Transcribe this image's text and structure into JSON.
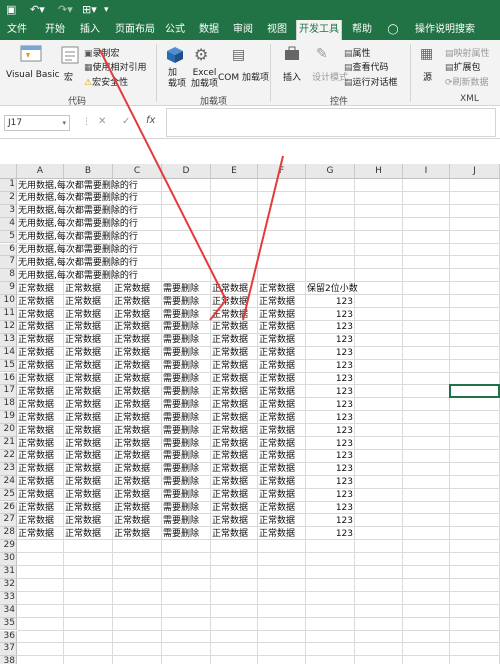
{
  "quick_access": {
    "save_icon": "save-icon",
    "undo_icon": "undo-icon",
    "redo_icon": "redo-icon",
    "touch_icon": "touch-mode-icon",
    "customize_icon": "customize-toolbar-icon"
  },
  "tabs": [
    {
      "label": "文件"
    },
    {
      "label": "开始"
    },
    {
      "label": "插入"
    },
    {
      "label": "页面布局"
    },
    {
      "label": "公式"
    },
    {
      "label": "数据"
    },
    {
      "label": "审阅"
    },
    {
      "label": "视图"
    },
    {
      "label": "开发工具"
    },
    {
      "label": "帮助"
    }
  ],
  "tell_me": "操作说明搜索",
  "ribbon": {
    "code": {
      "group": "代码",
      "visual_basic": "Visual Basic",
      "macros": "宏",
      "record": "录制宏",
      "relative": "使用相对引用",
      "security": "宏安全性"
    },
    "addins": {
      "group": "加载项",
      "addins": "加\n载项",
      "excel_addins": "Excel\n加载项",
      "com_addins": "COM 加载项"
    },
    "controls": {
      "group": "控件",
      "insert": "插入",
      "design_mode": "设计模式",
      "properties": "属性",
      "view_code": "查看代码",
      "run_dialog": "运行对话框"
    },
    "xml": {
      "group": "XML",
      "source": "源",
      "map_properties": "映射属性",
      "expansion": "扩展包",
      "refresh": "刷新数据"
    }
  },
  "formula_bar": {
    "name_box": "J17",
    "cancel": "✕",
    "enter": "✓",
    "fx": "fx",
    "formula": ""
  },
  "columns": [
    "A",
    "B",
    "C",
    "D",
    "E",
    "F",
    "G",
    "H",
    "I",
    "J"
  ],
  "rows": [
    [
      "无用数据,每次都需要删除的行",
      "",
      "",
      "",
      "",
      "",
      "",
      "",
      "",
      ""
    ],
    [
      "无用数据,每次都需要删除的行",
      "",
      "",
      "",
      "",
      "",
      "",
      "",
      "",
      ""
    ],
    [
      "无用数据,每次都需要删除的行",
      "",
      "",
      "",
      "",
      "",
      "",
      "",
      "",
      ""
    ],
    [
      "无用数据,每次都需要删除的行",
      "",
      "",
      "",
      "",
      "",
      "",
      "",
      "",
      ""
    ],
    [
      "无用数据,每次都需要删除的行",
      "",
      "",
      "",
      "",
      "",
      "",
      "",
      "",
      ""
    ],
    [
      "无用数据,每次都需要删除的行",
      "",
      "",
      "",
      "",
      "",
      "",
      "",
      "",
      ""
    ],
    [
      "无用数据,每次都需要删除的行",
      "",
      "",
      "",
      "",
      "",
      "",
      "",
      "",
      ""
    ],
    [
      "无用数据,每次都需要删除的行",
      "",
      "",
      "",
      "",
      "",
      "",
      "",
      "",
      ""
    ],
    [
      "正常数据",
      "正常数据",
      "正常数据",
      "需要删除",
      "正常数据",
      "正常数据",
      "保留2位小数",
      "",
      "",
      ""
    ],
    [
      "正常数据",
      "正常数据",
      "正常数据",
      "需要删除",
      "正常数据",
      "正常数据",
      "123",
      "",
      "",
      ""
    ],
    [
      "正常数据",
      "正常数据",
      "正常数据",
      "需要删除",
      "正常数据",
      "正常数据",
      "123",
      "",
      "",
      ""
    ],
    [
      "正常数据",
      "正常数据",
      "正常数据",
      "需要删除",
      "正常数据",
      "正常数据",
      "123",
      "",
      "",
      ""
    ],
    [
      "正常数据",
      "正常数据",
      "正常数据",
      "需要删除",
      "正常数据",
      "正常数据",
      "123",
      "",
      "",
      ""
    ],
    [
      "正常数据",
      "正常数据",
      "正常数据",
      "需要删除",
      "正常数据",
      "正常数据",
      "123",
      "",
      "",
      ""
    ],
    [
      "正常数据",
      "正常数据",
      "正常数据",
      "需要删除",
      "正常数据",
      "正常数据",
      "123",
      "",
      "",
      ""
    ],
    [
      "正常数据",
      "正常数据",
      "正常数据",
      "需要删除",
      "正常数据",
      "正常数据",
      "123",
      "",
      "",
      ""
    ],
    [
      "正常数据",
      "正常数据",
      "正常数据",
      "需要删除",
      "正常数据",
      "正常数据",
      "123",
      "",
      "",
      ""
    ],
    [
      "正常数据",
      "正常数据",
      "正常数据",
      "需要删除",
      "正常数据",
      "正常数据",
      "123",
      "",
      "",
      ""
    ],
    [
      "正常数据",
      "正常数据",
      "正常数据",
      "需要删除",
      "正常数据",
      "正常数据",
      "123",
      "",
      "",
      ""
    ],
    [
      "正常数据",
      "正常数据",
      "正常数据",
      "需要删除",
      "正常数据",
      "正常数据",
      "123",
      "",
      "",
      ""
    ],
    [
      "正常数据",
      "正常数据",
      "正常数据",
      "需要删除",
      "正常数据",
      "正常数据",
      "123",
      "",
      "",
      ""
    ],
    [
      "正常数据",
      "正常数据",
      "正常数据",
      "需要删除",
      "正常数据",
      "正常数据",
      "123",
      "",
      "",
      ""
    ],
    [
      "正常数据",
      "正常数据",
      "正常数据",
      "需要删除",
      "正常数据",
      "正常数据",
      "123",
      "",
      "",
      ""
    ],
    [
      "正常数据",
      "正常数据",
      "正常数据",
      "需要删除",
      "正常数据",
      "正常数据",
      "123",
      "",
      "",
      ""
    ],
    [
      "正常数据",
      "正常数据",
      "正常数据",
      "需要删除",
      "正常数据",
      "正常数据",
      "123",
      "",
      "",
      ""
    ],
    [
      "正常数据",
      "正常数据",
      "正常数据",
      "需要删除",
      "正常数据",
      "正常数据",
      "123",
      "",
      "",
      ""
    ],
    [
      "正常数据",
      "正常数据",
      "正常数据",
      "需要删除",
      "正常数据",
      "正常数据",
      "123",
      "",
      "",
      ""
    ],
    [
      "正常数据",
      "正常数据",
      "正常数据",
      "需要删除",
      "正常数据",
      "正常数据",
      "123",
      "",
      "",
      ""
    ],
    [
      "",
      "",
      "",
      "",
      "",
      "",
      "",
      "",
      "",
      ""
    ],
    [
      "",
      "",
      "",
      "",
      "",
      "",
      "",
      "",
      "",
      ""
    ],
    [
      "",
      "",
      "",
      "",
      "",
      "",
      "",
      "",
      "",
      ""
    ],
    [
      "",
      "",
      "",
      "",
      "",
      "",
      "",
      "",
      "",
      ""
    ],
    [
      "",
      "",
      "",
      "",
      "",
      "",
      "",
      "",
      "",
      ""
    ],
    [
      "",
      "",
      "",
      "",
      "",
      "",
      "",
      "",
      "",
      ""
    ],
    [
      "",
      "",
      "",
      "",
      "",
      "",
      "",
      "",
      "",
      ""
    ],
    [
      "",
      "",
      "",
      "",
      "",
      "",
      "",
      "",
      "",
      ""
    ],
    [
      "",
      "",
      "",
      "",
      "",
      "",
      "",
      "",
      "",
      ""
    ],
    [
      "",
      "",
      "",
      "",
      "",
      "",
      "",
      "",
      "",
      ""
    ],
    [
      "",
      "",
      "",
      "",
      "",
      "",
      "",
      "",
      "",
      ""
    ]
  ],
  "selected_cell": "J17",
  "colors": {
    "excel_green": "#217346",
    "annotation_red": "#e53a3a"
  }
}
